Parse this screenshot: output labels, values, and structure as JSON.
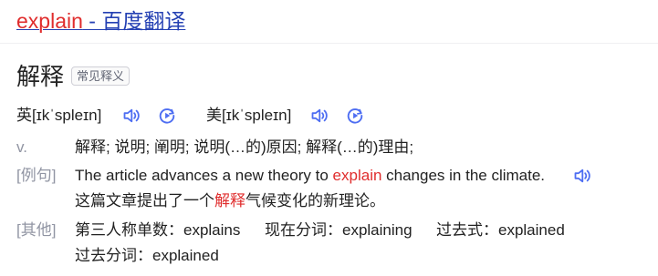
{
  "title": {
    "query": "explain",
    "suffix": " - 百度翻译"
  },
  "headword": {
    "text": "解释",
    "tag": "常见释义"
  },
  "phonetics": {
    "uk": {
      "label": "英",
      "ipa": "[ɪkˈspleɪn]"
    },
    "us": {
      "label": "美",
      "ipa": "[ɪkˈspleɪn]"
    }
  },
  "definition": {
    "pos": "v.",
    "text": "解释; 说明; 阐明; 说明(…的)原因; 解释(…的)理由;"
  },
  "example": {
    "label": "[例句]",
    "en_before": "The article advances a new theory to ",
    "en_highlight": "explain",
    "en_after": " changes in the climate.",
    "zh_before": "这篇文章提出了一个",
    "zh_highlight": "解释",
    "zh_after": "气候变化的新理论。"
  },
  "other": {
    "label": "[其他]",
    "third_person": "第三人称单数：explains",
    "present_participle": "现在分词：explaining",
    "past_tense": "过去式：explained",
    "past_participle": "过去分词：explained"
  },
  "colors": {
    "link": "#2440b3",
    "highlight": "#e02d2d",
    "icon": "#4e6ef2",
    "muted": "#9195a3"
  },
  "icons": [
    "speaker-icon",
    "play-circle-icon"
  ]
}
